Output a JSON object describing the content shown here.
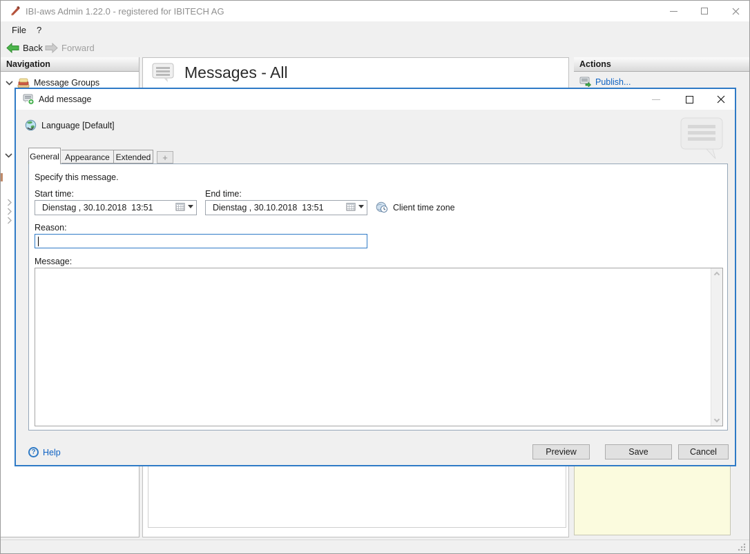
{
  "window": {
    "title": "IBI-aws Admin 1.22.0 - registered for IBITECH AG"
  },
  "menu": {
    "file": "File",
    "help": "?"
  },
  "toolbar": {
    "back": "Back",
    "forward": "Forward"
  },
  "navigation": {
    "header": "Navigation",
    "message_groups": "Message Groups"
  },
  "main": {
    "title": "Messages - All"
  },
  "actions": {
    "header": "Actions",
    "publish": "Publish..."
  },
  "dialog": {
    "title": "Add message",
    "language": "Language [Default]",
    "tabs": {
      "general": "General",
      "appearance": "Appearance",
      "extended": "Extended",
      "add": "+"
    },
    "instruction": "Specify this message.",
    "start_time_label": "Start time:",
    "end_time_label": "End time:",
    "start_time_value": "Dienstag , 30.10.2018  13:51",
    "end_time_value": "Dienstag , 30.10.2018  13:51",
    "client_time_zone": "Client time zone",
    "reason_label": "Reason:",
    "reason_value": "",
    "message_label": "Message:",
    "message_value": "",
    "help": "Help",
    "preview_button": "Preview",
    "save_button": "Save",
    "cancel_button": "Cancel"
  },
  "icons": {
    "question": "?"
  },
  "colors": {
    "dialog_border": "#2e7ac6",
    "focus_border": "#2e7ac6",
    "link": "#0e62c3",
    "note_background": "#fbfbde",
    "back_arrow": "#4db54d"
  }
}
